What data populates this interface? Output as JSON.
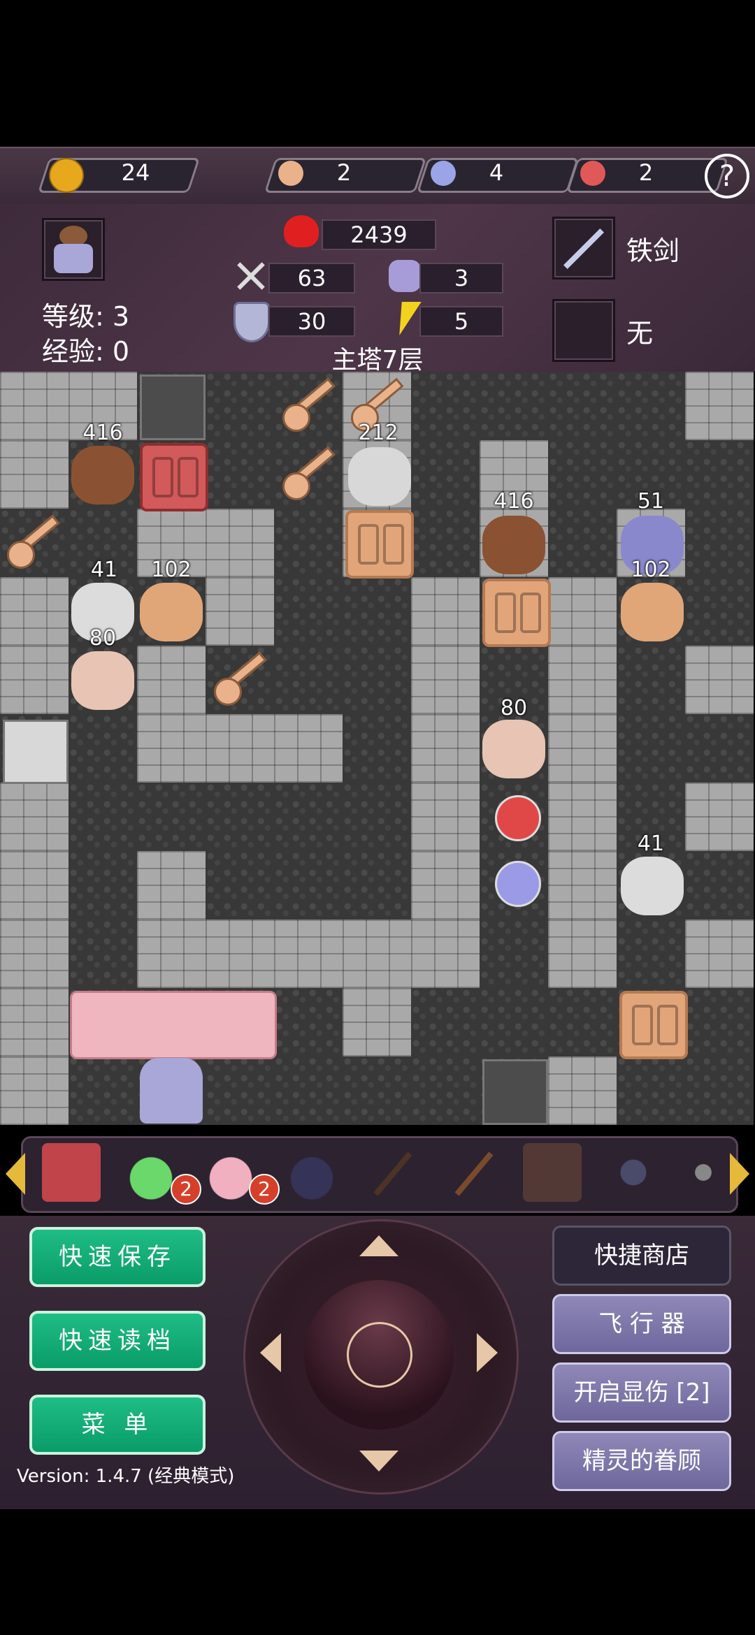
{
  "resources": {
    "coins": "24",
    "yellow_keys": "2",
    "blue_keys": "4",
    "red_keys": "2",
    "help": "?"
  },
  "hero": {
    "level_label": "等级: ",
    "level": "3",
    "exp_label": "经验: ",
    "exp": "0",
    "hp": "2439",
    "attack": "63",
    "defense": "30",
    "speed": "3",
    "magic": "5",
    "floor_name": "主塔7层",
    "weapon": "铁剑",
    "armor": "无"
  },
  "map_numbers": {
    "n1": "416",
    "n2": "212",
    "n3": "416",
    "n4": "51",
    "n5": "41",
    "n6": "102",
    "n7": "102",
    "n8": "80",
    "n9": "80",
    "n10": "41"
  },
  "items": {
    "green_potion_count": "2",
    "pink_potion_count": "2"
  },
  "buttons": {
    "quick_save": "快速保存",
    "quick_load": "快速读档",
    "menu": "菜 单",
    "quick_shop": "快捷商店",
    "flyer": "飞 行 器",
    "show_damage": "开启显伤 [2]",
    "spirit_favor": "精灵的眷顾"
  },
  "version": "Version: 1.4.7 (经典模式)"
}
